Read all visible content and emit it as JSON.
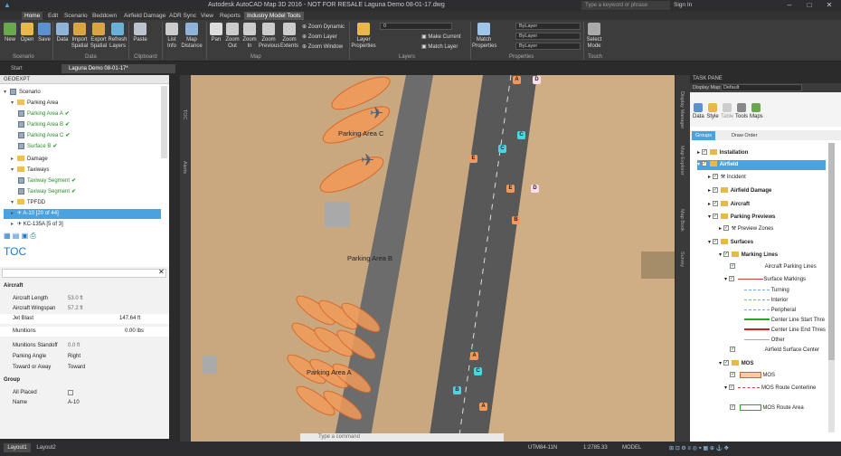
{
  "app": {
    "title": "Autodesk AutoCAD Map 3D 2016 - NOT FOR RESALE   Laguna Demo 08-01-17.dwg",
    "search_placeholder": "Type a keyword or phrase",
    "signin": "Sign In"
  },
  "menu": [
    "Home",
    "Edit",
    "Scenario",
    "Beddown",
    "Airfield Damage",
    "ADR Sync",
    "View",
    "Reports",
    "Industry Model Tools"
  ],
  "ribbon": {
    "buttons": [
      "New",
      "Open",
      "Save",
      "Data",
      "Import Spatial",
      "Export Spatial",
      "Refresh Layers",
      "Paste",
      "List Info",
      "Map Distance",
      "Pan",
      "Zoom Out",
      "Zoom In",
      "Zoom Previous",
      "Zoom Extents",
      "Layer Properties",
      "Match Properties",
      "Select Mode"
    ],
    "zoom_small": [
      "Zoom Dynamic",
      "Zoom Layer",
      "Zoom Window"
    ],
    "layer_small": [
      "Make Current",
      "Match Layer"
    ],
    "layer_value": "0",
    "prop_values": [
      "ByLayer",
      "ByLayer",
      "ByLayer"
    ],
    "groups": [
      "Scenario",
      "Data",
      "Clipboard",
      "Map",
      "Layers",
      "Properties",
      "Touch"
    ]
  },
  "doc_tabs": [
    "Start",
    "Laguna Demo 08-01-17*"
  ],
  "geoexpt": {
    "title": "GEOEXPT",
    "items": [
      {
        "label": "Scenario"
      },
      {
        "label": "Parking Area"
      },
      {
        "label": "Parking Area A"
      },
      {
        "label": "Parking Area B"
      },
      {
        "label": "Parking Area C"
      },
      {
        "label": "Surface B"
      },
      {
        "label": "Damage"
      },
      {
        "label": "Taxiways"
      },
      {
        "label": "Taxiway Segment"
      },
      {
        "label": "Taxiway Segment"
      },
      {
        "label": "TPFDD"
      },
      {
        "label": "A-10 [20 of 44]"
      },
      {
        "label": "KC-135A [5 of 3]"
      }
    ]
  },
  "toc_label": "TOC",
  "properties": {
    "section1": "Aircraft",
    "rows": [
      {
        "k": "Aircraft Length",
        "v": "53.0 ft"
      },
      {
        "k": "Aircraft Wingspan",
        "v": "57.2 ft"
      },
      {
        "k": "Jet Blast",
        "v": "147.64  ft"
      },
      {
        "k": "Munitions",
        "v": "0.00  lbs"
      },
      {
        "k": "Munitions Standoff",
        "v": "0.0 ft"
      },
      {
        "k": "Parking Angle",
        "v": "Right"
      },
      {
        "k": "Toward or Away",
        "v": "Toward"
      }
    ],
    "section2": "Group",
    "rows2": [
      {
        "k": "All Placed",
        "v": ""
      },
      {
        "k": "Name",
        "v": "A-10"
      }
    ]
  },
  "map": {
    "labels": [
      "Parking Area C",
      "Parking Area B",
      "Parking Area A"
    ],
    "side_tabs": [
      "TOC",
      "Alerts"
    ]
  },
  "task": {
    "title": "TASK PANE",
    "display_map_label": "Display Map:",
    "display_map_value": "Default",
    "tools": [
      "Data",
      "Style",
      "Table",
      "Tools",
      "Maps"
    ],
    "tabs": [
      "Groups",
      "Draw Order"
    ],
    "items": [
      "Installation",
      "Airfield",
      "Incident",
      "Airfield Damage",
      "Aircraft",
      "Parking Previews",
      "Preview Zones",
      "Surfaces",
      "Marking Lines",
      "Aircraft Parking Lines",
      "Surface Markings",
      "Turning",
      "Interior",
      "Peripheral",
      "Center Line Start Thre",
      "Center Line End Thres",
      "Other",
      "Airfield Surface Center",
      "MOS",
      "MOS",
      "MOS Route Centerline",
      "",
      "MOS Route Area"
    ],
    "side_tabs": [
      "Display Manager",
      "Map Explorer",
      "Map Book",
      "Survey"
    ]
  },
  "command_placeholder": "Type a command",
  "status": {
    "layouts": [
      "Layout1",
      "Layout2"
    ],
    "items": [
      "UTM84-11N",
      "1:2785.33",
      "MODEL"
    ]
  }
}
